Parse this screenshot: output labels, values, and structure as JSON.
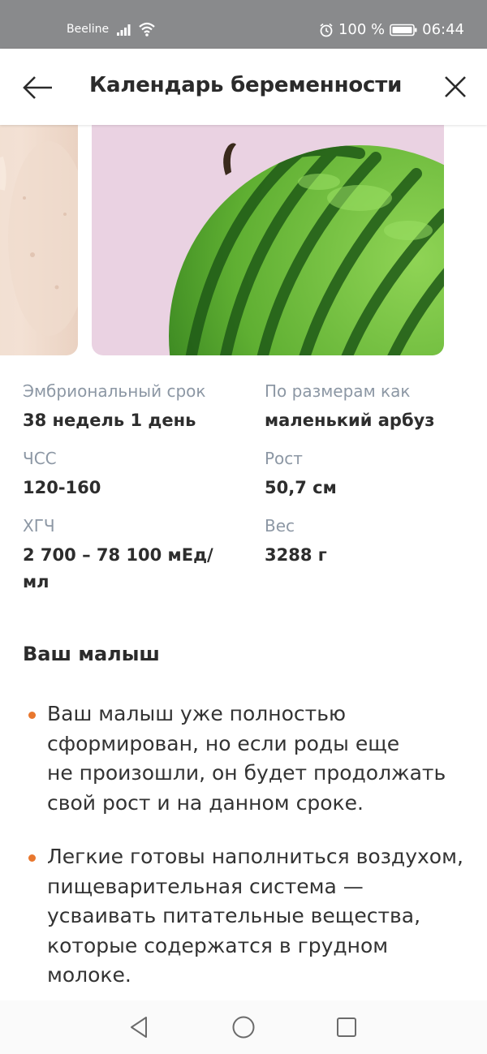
{
  "status_bar": {
    "carrier": "Beeline",
    "battery": "100 %",
    "time": "06:44"
  },
  "app_bar": {
    "title": "Календарь беременности"
  },
  "colors": {
    "accent": "#e8772e",
    "label": "#8c97a4",
    "status_bar_bg": "#898a8c",
    "card_bg": "#ead2e2"
  },
  "fruit_card": {
    "image": "watermelon-image"
  },
  "info": {
    "embryonic_term": {
      "label": "Эмбриональный срок",
      "value": "38 недель 1 день"
    },
    "size_as": {
      "label": "По размерам как",
      "value": "маленький арбуз"
    },
    "heart_rate": {
      "label": "ЧСС",
      "value": "120-160"
    },
    "height": {
      "label": "Рост",
      "value": "50,7 см"
    },
    "hcg": {
      "label": "ХГЧ",
      "value_line1": "2 700 – 78 100 мЕд/",
      "value_line2": "мл"
    },
    "weight": {
      "label": "Вес",
      "value": "3288 г"
    }
  },
  "baby_section": {
    "title": "Ваш малыш",
    "bullets": [
      {
        "line1": "Ваш малыш уже полностью",
        "line2": "сформирован, но если роды еще",
        "line3": "не произошли, он будет продолжать",
        "line4": "свой рост и на данном сроке."
      },
      {
        "line1": "Легкие готовы наполниться воздухом,",
        "line2": "пищеварительная система —",
        "line3": "усваивать питательные вещества,",
        "line4": "которые содержатся в грудном",
        "line5": "молоке."
      }
    ]
  }
}
